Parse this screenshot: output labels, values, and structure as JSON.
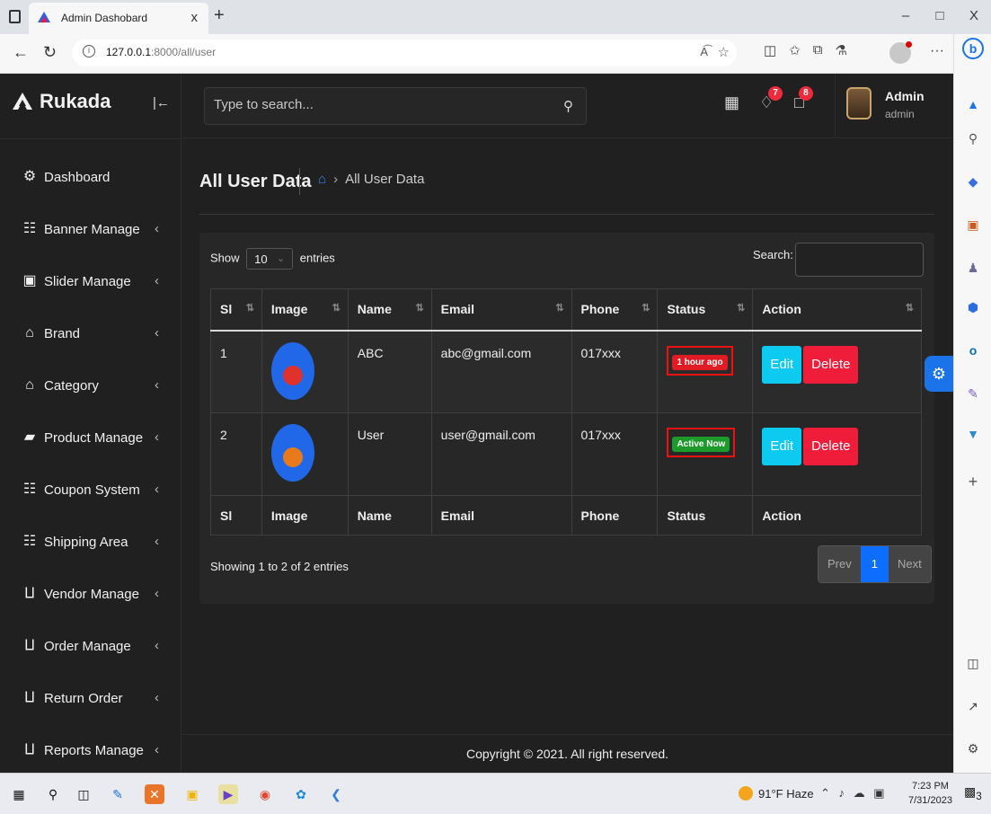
{
  "browser": {
    "tab_title": "Admin Dashobard",
    "tab_close": "x",
    "new_tab": "+",
    "url_host": "127.0.0.1",
    "url_rest": ":8000/all/user",
    "read_aloud": "A͡",
    "window_controls": [
      "–",
      "□",
      "X"
    ],
    "more": "···"
  },
  "sidebar": {
    "brand": "Rukada",
    "collapse_icon": "|←",
    "items": [
      {
        "label": "Dashboard",
        "icon": "dashboard-icon",
        "glyph": "⚙",
        "has_submenu": false
      },
      {
        "label": "Banner Manage",
        "icon": "grid-icon",
        "glyph": "☷",
        "has_submenu": true
      },
      {
        "label": "Slider Manage",
        "icon": "images-icon",
        "glyph": "▣",
        "has_submenu": true
      },
      {
        "label": "Brand",
        "icon": "home-icon",
        "glyph": "⌂",
        "has_submenu": true
      },
      {
        "label": "Category",
        "icon": "home-icon",
        "glyph": "⌂",
        "has_submenu": true
      },
      {
        "label": "Product Manage",
        "icon": "bag-icon",
        "glyph": "▰",
        "has_submenu": true
      },
      {
        "label": "Coupon System",
        "icon": "grid-icon",
        "glyph": "☷",
        "has_submenu": true
      },
      {
        "label": "Shipping Area",
        "icon": "grid-icon",
        "glyph": "☷",
        "has_submenu": true
      },
      {
        "label": "Vendor Manage",
        "icon": "cart-icon",
        "glyph": "⨿",
        "has_submenu": true
      },
      {
        "label": "Order Manage",
        "icon": "cart-icon",
        "glyph": "⨿",
        "has_submenu": true
      },
      {
        "label": "Return Order",
        "icon": "cart-icon",
        "glyph": "⨿",
        "has_submenu": true
      },
      {
        "label": "Reports Manage",
        "icon": "cart-icon",
        "glyph": "⨿",
        "has_submenu": true
      }
    ]
  },
  "header": {
    "search_placeholder": "Type to search...",
    "notifications_count": "7",
    "messages_count": "8",
    "user_name": "Admin",
    "user_role": "admin"
  },
  "page": {
    "title": "All User Data",
    "breadcrumb_current": "All User Data",
    "show_label": "Show",
    "entries_label": "entries",
    "length_value": "10",
    "search_label": "Search:",
    "columns": [
      "Sl",
      "Image",
      "Name",
      "Email",
      "Phone",
      "Status",
      "Action"
    ],
    "rows": [
      {
        "sl": "1",
        "name": "ABC",
        "email": "abc@gmail.com",
        "phone": "017xxx",
        "status": "1 hour ago",
        "status_color": "#e01b24",
        "fruit_color": "#e0322d"
      },
      {
        "sl": "2",
        "name": "User",
        "email": "user@gmail.com",
        "phone": "017xxx",
        "status": "Active Now",
        "status_color": "#1c9a2a",
        "fruit_color": "#e97a1b"
      }
    ],
    "edit_label": "Edit",
    "delete_label": "Delete",
    "info_text": "Showing 1 to 2 of 2 entries",
    "pager": {
      "prev": "Prev",
      "current": "1",
      "next": "Next"
    }
  },
  "footer": {
    "copyright": "Copyright © 2021. All right reserved."
  },
  "taskbar": {
    "weather": "91°F  Haze",
    "time": "7:23 PM",
    "date": "7/31/2023",
    "notif_count": "3"
  },
  "colors": {
    "accent": "#0d6efd",
    "danger": "#ef1c3a",
    "info": "#0dcaf0",
    "background": "#202020"
  }
}
